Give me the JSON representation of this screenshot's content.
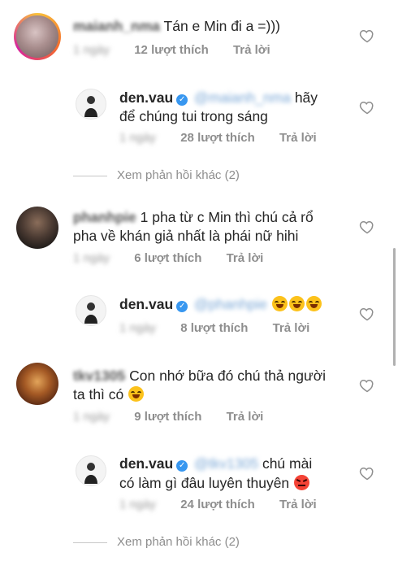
{
  "comments": [
    {
      "username": "maianh_nma",
      "text": "Tán e Min đi a =)))",
      "time": "1 ngày",
      "likes": "12 lượt thích",
      "reply_label": "Trả lời"
    },
    {
      "username": "den.vau",
      "mention": "@maianh_nma",
      "text_line1": "hãy",
      "text_line2": "để chúng tui trong sáng",
      "time": "1 ngày",
      "likes": "28 lượt thích",
      "reply_label": "Trả lời"
    },
    {
      "view_more": "Xem phản hồi khác (2)"
    },
    {
      "username": "phanhpie",
      "text_line1": "1 pha từ c Min thì chú cả rổ",
      "text_line2": "pha về khán giả nhất là phái nữ hihi",
      "time": "1 ngày",
      "likes": "6 lượt thích",
      "reply_label": "Trả lời"
    },
    {
      "username": "den.vau",
      "mention": "@phanhpie",
      "time": "1 ngày",
      "likes": "8 lượt thích",
      "reply_label": "Trả lời"
    },
    {
      "username": "tkv1305",
      "text_line1": "Con nhớ bữa đó chú thả người",
      "text_line2": "ta thì có",
      "time": "1 ngày",
      "likes": "9 lượt thích",
      "reply_label": "Trả lời"
    },
    {
      "username": "den.vau",
      "mention": "@tkv1305",
      "text_line1": "chú mài",
      "text_line2": "có làm gì đâu luyên thuyên",
      "time": "1 ngày",
      "likes": "24 lượt thích",
      "reply_label": "Trả lời"
    },
    {
      "view_more": "Xem phản hồi khác (2)"
    }
  ],
  "icons": {
    "heart": "heart-outline-icon",
    "verified": "verified-badge-icon",
    "emoji_laugh": "face-with-tears-of-joy-emoji",
    "emoji_angry": "angry-face-emoji"
  },
  "colors": {
    "primary_text": "#262626",
    "secondary_text": "#8e8e8e",
    "verified_blue": "#3897f0"
  }
}
